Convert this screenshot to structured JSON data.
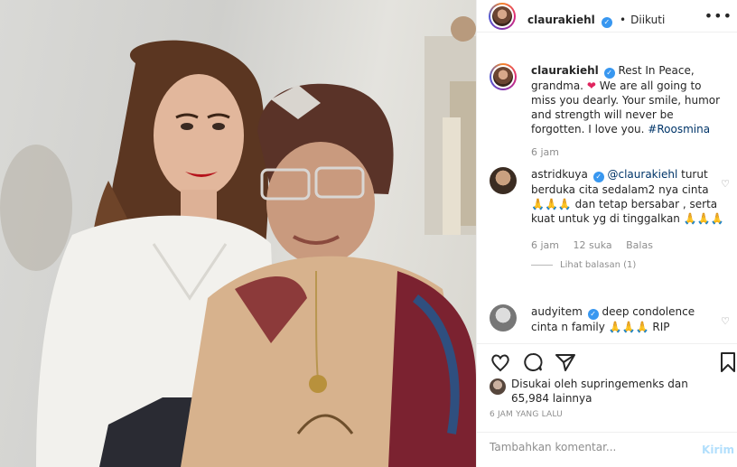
{
  "header": {
    "username": "claurakiehl",
    "verified_mark": "✓",
    "separator": "•",
    "follow_status": "Diikuti",
    "more_label": "•••"
  },
  "caption": {
    "username": "claurakiehl",
    "text_before": "Rest In Peace, grandma.",
    "heart": "❤",
    "text_after": "We are all going to miss you dearly. Your smile, humor and strength will never be forgotten. I love you.",
    "hashtag": "#Roosmina",
    "time": "6 jam"
  },
  "comments": [
    {
      "username": "astridkuya",
      "mention": "@claurakiehl",
      "text": "turut berduka cita sedalam2 nya cinta",
      "emoji1": "🙏🙏🙏",
      "text2": "dan tetap bersabar , serta kuat untuk yg di tinggalkan",
      "emoji2": "🙏🙏🙏",
      "time": "6 jam",
      "likes": "12 suka",
      "reply": "Balas",
      "view_replies": "Lihat balasan (1)"
    },
    {
      "username": "audyitem",
      "text": "deep condolence cinta n family",
      "emoji": "🙏🙏🙏",
      "text2": "RIP"
    }
  ],
  "likes": {
    "prefix": "Disukai oleh",
    "liker": "supringemenks",
    "joiner": "dan",
    "others": "65,984 lainnya"
  },
  "time_ago": "6 JAM YANG LALU",
  "add_comment": {
    "placeholder": "Tambahkan komentar...",
    "post_label": "Kirim"
  },
  "colors": {
    "link": "#003569",
    "verified": "#3897f0",
    "muted": "#8e8e8e",
    "post_disabled": "#b2dffc"
  },
  "icons": {
    "like": "heart-icon",
    "comment": "comment-icon",
    "share": "share-icon",
    "save": "bookmark-icon"
  }
}
